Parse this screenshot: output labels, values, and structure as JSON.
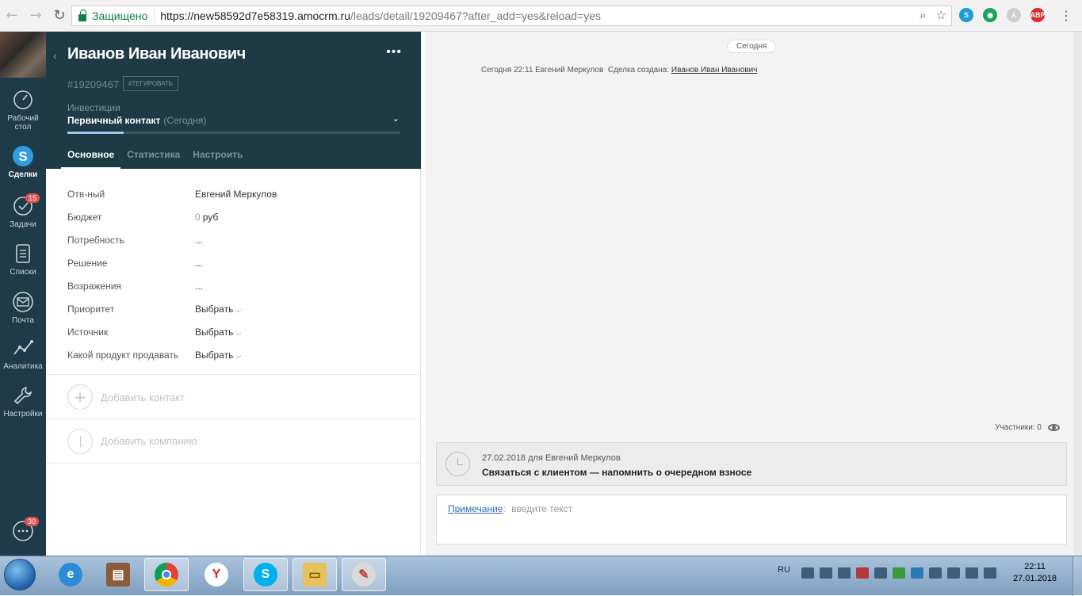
{
  "browser": {
    "secure_label": "Защищено",
    "url_host": "https://new58592d7e58319.amocrm.ru",
    "url_rest": "/leads/detail/19209467?after_add=yes&reload=yes"
  },
  "leftnav": {
    "items": [
      {
        "label": "Рабочий стол",
        "icon": "dashboard-icon"
      },
      {
        "label": "Сделки",
        "icon": "deals-icon",
        "active": true
      },
      {
        "label": "Задачи",
        "icon": "tasks-icon",
        "badge": "15"
      },
      {
        "label": "Списки",
        "icon": "lists-icon"
      },
      {
        "label": "Почта",
        "icon": "mail-icon"
      },
      {
        "label": "Аналитика",
        "icon": "analytics-icon"
      },
      {
        "label": "Настройки",
        "icon": "settings-icon"
      }
    ],
    "chat_badge": "30"
  },
  "lead": {
    "name": "Иванов Иван Иванович",
    "id": "#19209467",
    "tag_button": "#тегировать",
    "pipeline": "Инвестиции",
    "status": "Первичный контакт",
    "status_date": "(Сегодня)",
    "pipeline_progress": 0.17,
    "tabs": [
      "Основное",
      "Статистика",
      "Настроить"
    ],
    "fields": [
      {
        "label": "Отв-ный",
        "value": "Евгений Меркулов"
      },
      {
        "label": "Бюджет",
        "zero": "0",
        "value": "руб"
      },
      {
        "label": "Потребность",
        "value": "..."
      },
      {
        "label": "Решение",
        "value": "..."
      },
      {
        "label": "Возражения",
        "value": "..."
      },
      {
        "label": "Приоритет",
        "value": "Выбрать"
      },
      {
        "label": "Источник",
        "value": "Выбрать"
      },
      {
        "label": "Какой продукт продавать",
        "value": "Выбрать"
      }
    ],
    "add_contact": "Добавить контакт",
    "add_company": "Добавить компанию"
  },
  "feed": {
    "today_label": "Сегодня",
    "event_time": "Сегодня 22:11",
    "event_user": "Евгений Меркулов",
    "event_text": "Сделка создана:",
    "event_link": "Иванов Иван Иванович",
    "participants": "Участники: 0",
    "task_meta": "27.02.2018 для Евгений Меркулов",
    "task_text": "Связаться с клиентом — напомнить о очередном взносе",
    "note_link": "Примечание",
    "note_placeholder": "введите текст"
  },
  "taskbar": {
    "lang": "RU",
    "time": "22:11",
    "date": "27.01.2018"
  }
}
